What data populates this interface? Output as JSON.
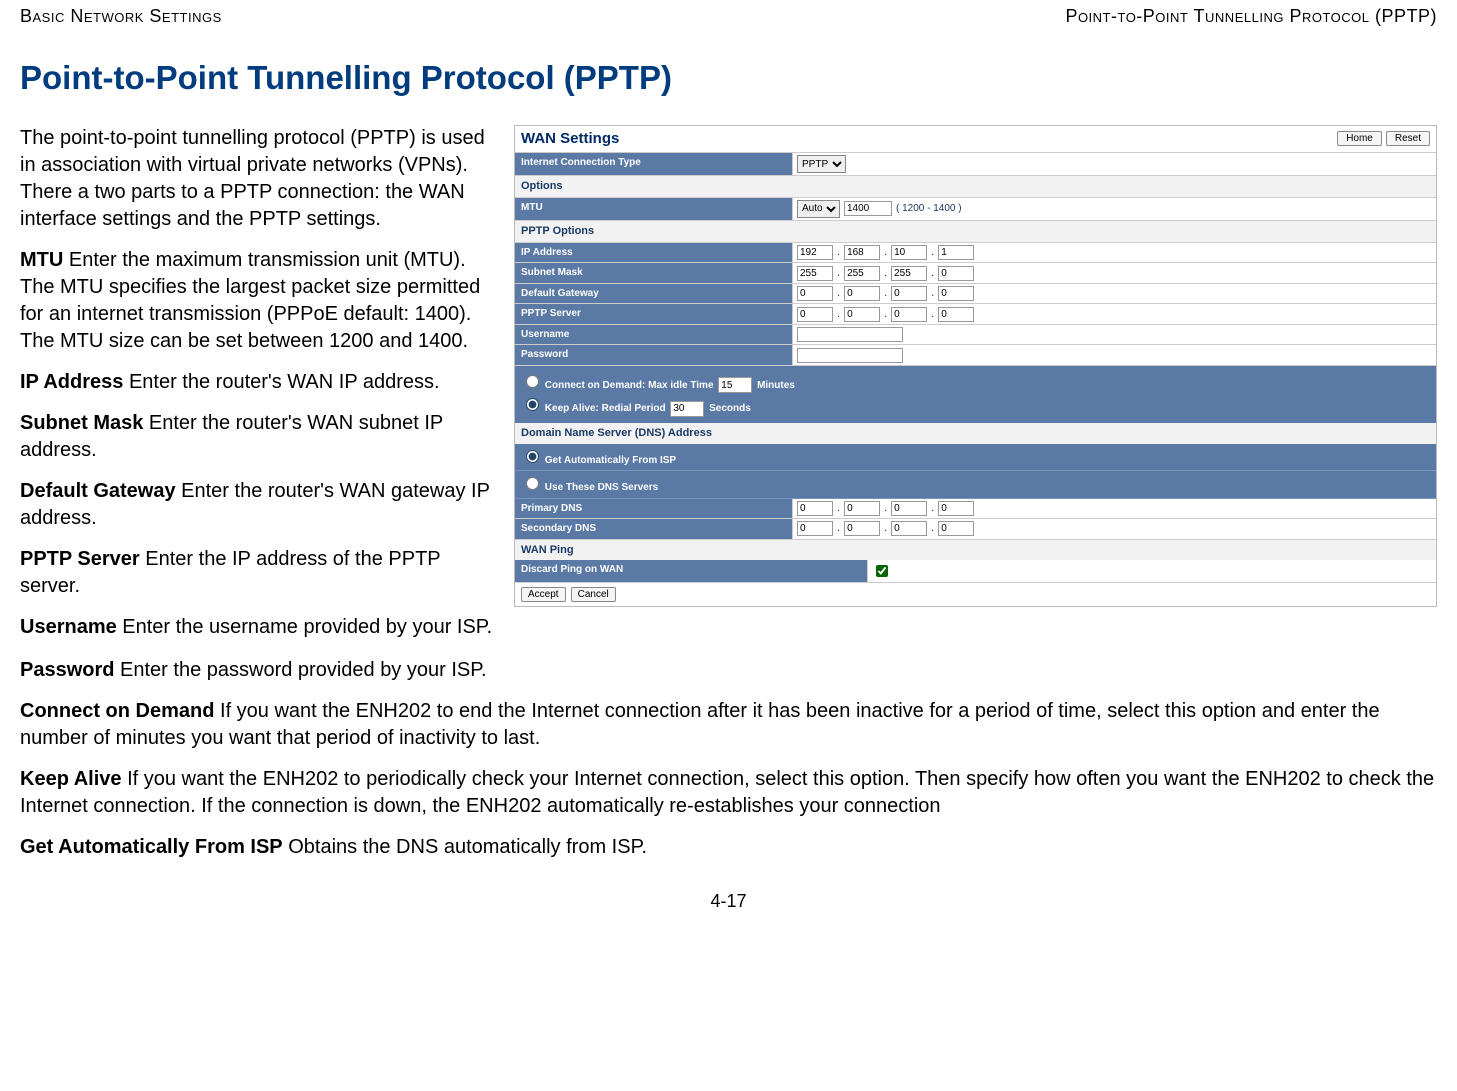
{
  "header": {
    "left": "Basic Network Settings",
    "right": "Point-to-Point Tunnelling Protocol (PPTP)"
  },
  "title": "Point-to-Point Tunnelling Protocol (PPTP)",
  "left": {
    "intro": "The point-to-point tunnelling protocol (PPTP) is used in association with virtual private networks (VPNs). There a two parts to a PPTP connection: the WAN interface settings and the PPTP settings.",
    "mtu_b": "MTU",
    "mtu_t": "  Enter the maximum transmission unit (MTU). The MTU specifies the largest packet size permitted for an internet transmission (PPPoE default: 1400). The MTU size can be set between 1200 and 1400.",
    "ip_b": "IP Address",
    "ip_t": "  Enter the router's WAN IP address.",
    "sm_b": "Subnet Mask",
    "sm_t": "  Enter the router's WAN subnet IP address.",
    "dg_b": "Default Gateway",
    "dg_t": "  Enter the router's WAN gateway IP address.",
    "ps_b": "PPTP Server",
    "ps_t": "  Enter the IP address of the PPTP server.",
    "un_b": "Username",
    "un_t": "  Enter the username provided by your ISP."
  },
  "full": {
    "pw_b": "Password",
    "pw_t": "  Enter the password provided by your ISP.",
    "cod_b": "Connect on Demand",
    "cod_t": "  If you want the ENH202 to end the Internet connection after it has been inactive for a period of time, select this option and enter the number of minutes you want that period of inactivity to last.",
    "ka_b": "Keep Alive",
    "ka_t": "  If you want the ENH202 to periodically check your Internet connection, select this option. Then specify how often you want the ENH202 to check the Internet connection. If the connection is down, the ENH202 automatically re-establishes your connection",
    "ga_b": "Get Automatically From ISP",
    "ga_t": "  Obtains the DNS automatically from ISP."
  },
  "ss": {
    "panel_title": "WAN Settings",
    "home": "Home",
    "reset": "Reset",
    "ict_label": "Internet Connection Type",
    "ict_value": "PPTP",
    "options_label": "Options",
    "mtu_label": "MTU",
    "mtu_mode": "Auto",
    "mtu_val": "1400",
    "mtu_range": "( 1200 - 1400 )",
    "pptp_options": "PPTP Options",
    "rows": {
      "ip": {
        "label": "IP Address",
        "v": [
          "192",
          "168",
          "10",
          "1"
        ]
      },
      "sm": {
        "label": "Subnet Mask",
        "v": [
          "255",
          "255",
          "255",
          "0"
        ]
      },
      "dg": {
        "label": "Default Gateway",
        "v": [
          "0",
          "0",
          "0",
          "0"
        ]
      },
      "psrv": {
        "label": "PPTP Server",
        "v": [
          "0",
          "0",
          "0",
          "0"
        ]
      },
      "user": {
        "label": "Username",
        "v": ""
      },
      "pass": {
        "label": "Password",
        "v": ""
      }
    },
    "cod_label": "Connect on Demand: Max idle Time",
    "cod_val": "15",
    "cod_unit": "Minutes",
    "ka_label": "Keep Alive: Redial Period",
    "ka_val": "30",
    "ka_unit": "Seconds",
    "dns_hdr": "Domain Name Server (DNS) Address",
    "dns_auto": "Get Automatically From ISP",
    "dns_use": "Use These DNS Servers",
    "pdns": {
      "label": "Primary DNS",
      "v": [
        "0",
        "0",
        "0",
        "0"
      ]
    },
    "sdns": {
      "label": "Secondary DNS",
      "v": [
        "0",
        "0",
        "0",
        "0"
      ]
    },
    "wanping": "WAN Ping",
    "discard": "Discard Ping on WAN",
    "accept": "Accept",
    "cancel": "Cancel"
  },
  "footer": "4-17"
}
